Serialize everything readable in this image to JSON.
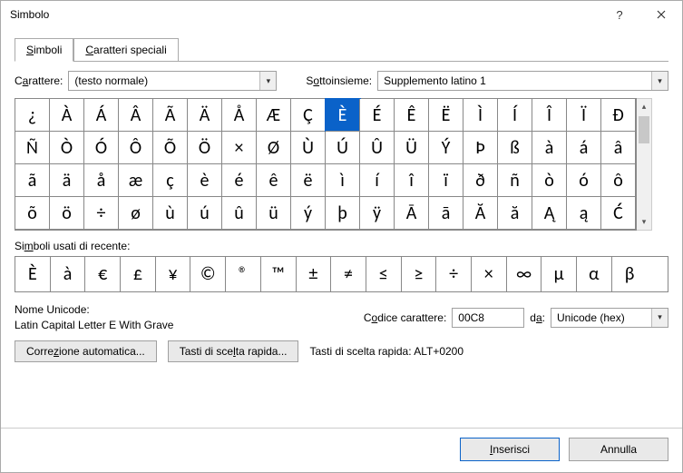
{
  "window": {
    "title": "Simbolo"
  },
  "tabs": {
    "symbols": "Simboli",
    "special": "Caratteri speciali"
  },
  "font": {
    "label_pre": "C",
    "label_ul": "a",
    "label_post": "rattere:",
    "value": "(testo normale)"
  },
  "subset": {
    "label_pre": "S",
    "label_ul": "o",
    "label_post": "ttoinsieme:",
    "value": "Supplemento latino 1"
  },
  "grid_chars": [
    "¿",
    "À",
    "Á",
    "Â",
    "Ã",
    "Ä",
    "Å",
    "Æ",
    "Ç",
    "È",
    "É",
    "Ê",
    "Ë",
    "Ì",
    "Í",
    "Î",
    "Ï",
    "Ð",
    "Ñ",
    "Ò",
    "Ó",
    "Ô",
    "Õ",
    "Ö",
    "×",
    "Ø",
    "Ù",
    "Ú",
    "Û",
    "Ü",
    "Ý",
    "Þ",
    "ß",
    "à",
    "á",
    "â",
    "ã",
    "ä",
    "å",
    "æ",
    "ç",
    "è",
    "é",
    "ê",
    "ë",
    "ì",
    "í",
    "î",
    "ï",
    "ð",
    "ñ",
    "ò",
    "ó",
    "ô",
    "õ",
    "ö",
    "÷",
    "ø",
    "ù",
    "ú",
    "û",
    "ü",
    "ý",
    "þ",
    "ÿ",
    "Ā",
    "ā",
    "Ă",
    "ă",
    "Ą",
    "ą",
    "Ć"
  ],
  "selected_index": 9,
  "recent_label": "Si",
  "recent_label_ul": "m",
  "recent_label_post": "boli usati di recente:",
  "recent_chars": [
    "È",
    "à",
    "€",
    "£",
    "¥",
    "©",
    "®",
    "™",
    "±",
    "≠",
    "≤",
    "≥",
    "÷",
    "×",
    "∞",
    "µ",
    "α",
    "β"
  ],
  "unicode": {
    "name_label": "Nome Unicode:",
    "name_value": "Latin Capital Letter E With Grave",
    "code_label_pre": "C",
    "code_label_ul": "o",
    "code_label_post": "dice carattere:",
    "code_value": "00C8",
    "from_label_pre": "d",
    "from_label_ul": "a",
    "from_label_post": ":",
    "from_value": "Unicode (hex)"
  },
  "buttons": {
    "autocorrect": "Correzione automatica...",
    "shortcut": "Tasti di scelta rapida...",
    "shortcut_display": "Tasti di scelta rapida: ALT+0200",
    "insert_pre": "",
    "insert_ul": "I",
    "insert_post": "nserisci",
    "cancel": "Annulla"
  }
}
